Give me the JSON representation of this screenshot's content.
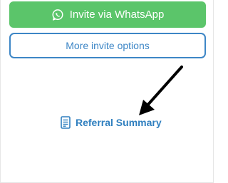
{
  "buttons": {
    "whatsapp_label": "Invite via WhatsApp",
    "more_label": "More invite options"
  },
  "links": {
    "referral_summary": "Referral Summary"
  },
  "icons": {
    "whatsapp": "whatsapp-icon",
    "document": "document-icon",
    "arrow": "arrow-pointer-icon"
  },
  "colors": {
    "whatsapp_green": "#5bc56a",
    "accent_blue": "#3d86c6",
    "link_blue": "#2f7fbf"
  }
}
